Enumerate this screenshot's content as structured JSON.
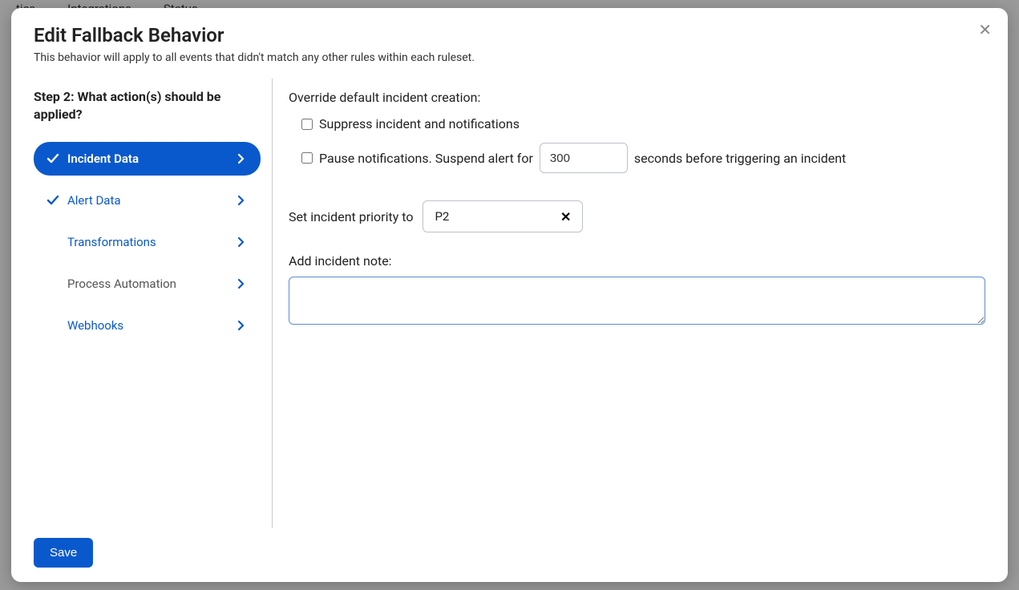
{
  "bg_nav": {
    "item1": "tics",
    "item2": "Integrations",
    "item3": "Status"
  },
  "modal": {
    "title": "Edit Fallback Behavior",
    "subtitle": "This behavior will apply to all events that didn't match any other rules within each ruleset."
  },
  "sidebar": {
    "step_title": "Step 2: What action(s) should be applied?",
    "items": [
      {
        "label": "Incident Data"
      },
      {
        "label": "Alert Data"
      },
      {
        "label": "Transformations"
      },
      {
        "label": "Process Automation"
      },
      {
        "label": "Webhooks"
      }
    ]
  },
  "content": {
    "override_label": "Override default incident creation:",
    "suppress_label": "Suppress incident and notifications",
    "pause_label_pre": "Pause notifications. Suspend alert for",
    "pause_seconds_value": "300",
    "pause_label_post": "seconds before triggering an incident",
    "priority_label": "Set incident priority to",
    "priority_value": "P2",
    "note_label": "Add incident note:",
    "note_value": ""
  },
  "footer": {
    "save_label": "Save"
  }
}
